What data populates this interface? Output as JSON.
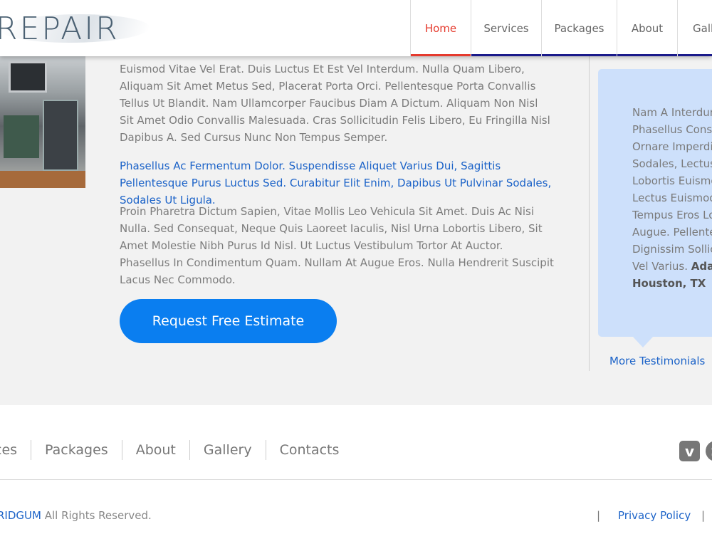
{
  "header": {
    "logo_text": "REPAIR",
    "nav": [
      {
        "label": "Home",
        "active": true
      },
      {
        "label": "Services",
        "active": false
      },
      {
        "label": "Packages",
        "active": false
      },
      {
        "label": "About",
        "active": false
      },
      {
        "label": "Gall",
        "active": false
      }
    ]
  },
  "main": {
    "paragraph1": "Euismod Vitae Vel Erat. Duis Luctus Et Est Vel Interdum. Nulla Quam Libero, Aliquam Sit Amet Metus Sed, Placerat Porta Orci. Pellentesque Porta Convallis Tellus Ut Blandit. Nam Ullamcorper Faucibus Diam A Dictum. Aliquam Non Nisl Sit Amet Odio Convallis Malesuada. Cras Sollicitudin Felis Libero, Eu Fringilla Nisl Dapibus A. Sed Cursus Nunc Non Tempus Semper.",
    "paragraph2": "Phasellus Ac Fermentum Dolor. Suspendisse Aliquet Varius Dui, Sagittis Pellentesque Purus Luctus Sed. Curabitur Elit Enim, Dapibus Ut Pulvinar Sodales, Sodales Ut Ligula.",
    "paragraph3": "Proin Pharetra Dictum Sapien, Vitae Mollis Leo Vehicula Sit Amet. Duis Ac Nisi Nulla. Sed Consequat, Neque Quis Laoreet Iaculis, Nisl Urna Lobortis Libero, Sit Amet Molestie Nibh Purus Id Nisl. Ut Luctus Vestibulum Tortor At Auctor. Phasellus In Condimentum Quam. Nullam At Augue Eros. Nulla Hendrerit Suscipit Lacus Nec Commodo.",
    "cta_label": "Request Free Estimate"
  },
  "sidebar": {
    "testimonial_lines": [
      "Nam A Interdum",
      "Phasellus Conse",
      "Ornare Imperdie",
      "Sodales, Lectus",
      "Lobortis Euismo",
      "Lectus Euismod",
      "Tempus Eros Lor",
      "Augue. Pellentes",
      "Dignissim Sollici"
    ],
    "testimonial_last_line": "Vel Varius.",
    "author": "Adam",
    "location": "Houston, TX",
    "more_label": "More Testimonials"
  },
  "footer": {
    "nav": [
      "ces",
      "Packages",
      "About",
      "Gallery",
      "Contacts"
    ],
    "social": [
      "vimeo-icon",
      "skype-icon"
    ],
    "social_glyphs": [
      "v",
      "S"
    ],
    "brand": "RIDGUM",
    "rights": " All Rights Reserved.",
    "separator": "|",
    "privacy_label": "Privacy Policy"
  }
}
